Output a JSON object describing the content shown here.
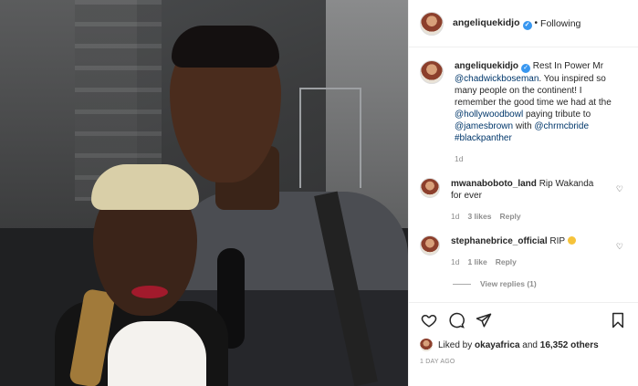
{
  "header": {
    "username": "angeliquekidjo",
    "separator": "•",
    "follow_status": "Following"
  },
  "caption": {
    "username": "angeliquekidjo",
    "parts": {
      "t1": "Rest In Power Mr ",
      "m1": "@chadwickboseman",
      "t2": ". You inspired so many people on the continent! I remember the good time we had at the ",
      "m2": "@hollywoodbowl",
      "t3": " paying tribute to ",
      "m3": "@jamesbrown",
      "t4": " with ",
      "m4": "@chrmcbride",
      "t5": " ",
      "m5": "#blackpanther"
    },
    "age": "1d"
  },
  "comments": [
    {
      "username": "mwanaboboto_land",
      "text": "Rip Wakanda for ever",
      "age": "1d",
      "likes": "3 likes",
      "reply": "Reply"
    },
    {
      "username": "stephanebrice_official",
      "text": "RIP",
      "age": "1d",
      "likes": "1 like",
      "reply": "Reply"
    }
  ],
  "view_replies": "View replies (1)",
  "liked_by": {
    "prefix": "Liked by ",
    "user": "okayafrica",
    "middle": " and ",
    "others": "16,352 others"
  },
  "date": "1 DAY AGO",
  "icons": {
    "verified": "✓",
    "heart": "♡",
    "like": "heart-icon",
    "comment": "comment-icon",
    "share": "share-icon",
    "save": "bookmark-icon"
  },
  "colors": {
    "link": "#00376b",
    "verified": "#3897f0",
    "muted": "#8e8e8e"
  }
}
